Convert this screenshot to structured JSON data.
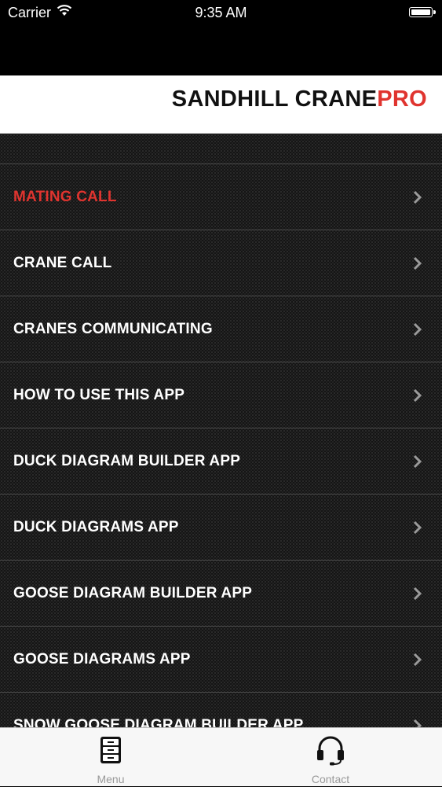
{
  "status_bar": {
    "carrier": "Carrier",
    "time": "9:35 AM"
  },
  "header": {
    "title_main": "SANDHILL CRANE",
    "title_suffix": "PRO",
    "accent_color": "#e0342f"
  },
  "menu": {
    "items": [
      {
        "label": "MATING CALL",
        "active": true
      },
      {
        "label": "CRANE CALL",
        "active": false
      },
      {
        "label": "CRANES COMMUNICATING",
        "active": false
      },
      {
        "label": "HOW TO USE THIS APP",
        "active": false
      },
      {
        "label": "DUCK DIAGRAM BUILDER APP",
        "active": false
      },
      {
        "label": "DUCK DIAGRAMS APP",
        "active": false
      },
      {
        "label": "GOOSE DIAGRAM BUILDER APP",
        "active": false
      },
      {
        "label": "GOOSE DIAGRAMS APP",
        "active": false
      },
      {
        "label": "SNOW GOOSE DIAGRAM BUILDER APP",
        "active": false
      }
    ]
  },
  "tab_bar": {
    "tabs": [
      {
        "label": "Menu",
        "icon": "file-cabinet-icon"
      },
      {
        "label": "Contact",
        "icon": "headset-icon"
      }
    ]
  }
}
